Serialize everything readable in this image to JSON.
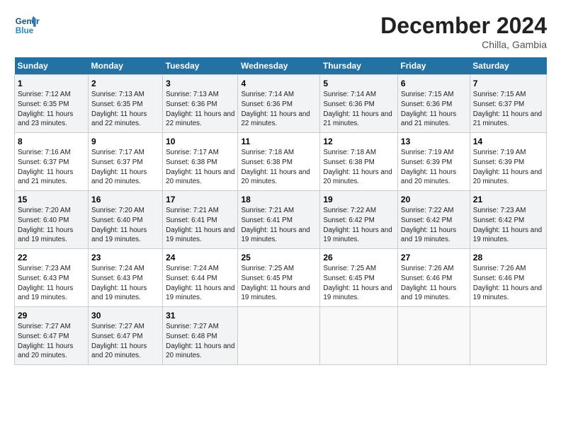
{
  "logo": {
    "line1": "General",
    "line2": "Blue"
  },
  "title": "December 2024",
  "subtitle": "Chilla, Gambia",
  "days_of_week": [
    "Sunday",
    "Monday",
    "Tuesday",
    "Wednesday",
    "Thursday",
    "Friday",
    "Saturday"
  ],
  "weeks": [
    [
      {
        "day": "1",
        "sunrise": "Sunrise: 7:12 AM",
        "sunset": "Sunset: 6:35 PM",
        "daylight": "Daylight: 11 hours and 23 minutes."
      },
      {
        "day": "2",
        "sunrise": "Sunrise: 7:13 AM",
        "sunset": "Sunset: 6:35 PM",
        "daylight": "Daylight: 11 hours and 22 minutes."
      },
      {
        "day": "3",
        "sunrise": "Sunrise: 7:13 AM",
        "sunset": "Sunset: 6:36 PM",
        "daylight": "Daylight: 11 hours and 22 minutes."
      },
      {
        "day": "4",
        "sunrise": "Sunrise: 7:14 AM",
        "sunset": "Sunset: 6:36 PM",
        "daylight": "Daylight: 11 hours and 22 minutes."
      },
      {
        "day": "5",
        "sunrise": "Sunrise: 7:14 AM",
        "sunset": "Sunset: 6:36 PM",
        "daylight": "Daylight: 11 hours and 21 minutes."
      },
      {
        "day": "6",
        "sunrise": "Sunrise: 7:15 AM",
        "sunset": "Sunset: 6:36 PM",
        "daylight": "Daylight: 11 hours and 21 minutes."
      },
      {
        "day": "7",
        "sunrise": "Sunrise: 7:15 AM",
        "sunset": "Sunset: 6:37 PM",
        "daylight": "Daylight: 11 hours and 21 minutes."
      }
    ],
    [
      {
        "day": "8",
        "sunrise": "Sunrise: 7:16 AM",
        "sunset": "Sunset: 6:37 PM",
        "daylight": "Daylight: 11 hours and 21 minutes."
      },
      {
        "day": "9",
        "sunrise": "Sunrise: 7:17 AM",
        "sunset": "Sunset: 6:37 PM",
        "daylight": "Daylight: 11 hours and 20 minutes."
      },
      {
        "day": "10",
        "sunrise": "Sunrise: 7:17 AM",
        "sunset": "Sunset: 6:38 PM",
        "daylight": "Daylight: 11 hours and 20 minutes."
      },
      {
        "day": "11",
        "sunrise": "Sunrise: 7:18 AM",
        "sunset": "Sunset: 6:38 PM",
        "daylight": "Daylight: 11 hours and 20 minutes."
      },
      {
        "day": "12",
        "sunrise": "Sunrise: 7:18 AM",
        "sunset": "Sunset: 6:38 PM",
        "daylight": "Daylight: 11 hours and 20 minutes."
      },
      {
        "day": "13",
        "sunrise": "Sunrise: 7:19 AM",
        "sunset": "Sunset: 6:39 PM",
        "daylight": "Daylight: 11 hours and 20 minutes."
      },
      {
        "day": "14",
        "sunrise": "Sunrise: 7:19 AM",
        "sunset": "Sunset: 6:39 PM",
        "daylight": "Daylight: 11 hours and 20 minutes."
      }
    ],
    [
      {
        "day": "15",
        "sunrise": "Sunrise: 7:20 AM",
        "sunset": "Sunset: 6:40 PM",
        "daylight": "Daylight: 11 hours and 19 minutes."
      },
      {
        "day": "16",
        "sunrise": "Sunrise: 7:20 AM",
        "sunset": "Sunset: 6:40 PM",
        "daylight": "Daylight: 11 hours and 19 minutes."
      },
      {
        "day": "17",
        "sunrise": "Sunrise: 7:21 AM",
        "sunset": "Sunset: 6:41 PM",
        "daylight": "Daylight: 11 hours and 19 minutes."
      },
      {
        "day": "18",
        "sunrise": "Sunrise: 7:21 AM",
        "sunset": "Sunset: 6:41 PM",
        "daylight": "Daylight: 11 hours and 19 minutes."
      },
      {
        "day": "19",
        "sunrise": "Sunrise: 7:22 AM",
        "sunset": "Sunset: 6:42 PM",
        "daylight": "Daylight: 11 hours and 19 minutes."
      },
      {
        "day": "20",
        "sunrise": "Sunrise: 7:22 AM",
        "sunset": "Sunset: 6:42 PM",
        "daylight": "Daylight: 11 hours and 19 minutes."
      },
      {
        "day": "21",
        "sunrise": "Sunrise: 7:23 AM",
        "sunset": "Sunset: 6:42 PM",
        "daylight": "Daylight: 11 hours and 19 minutes."
      }
    ],
    [
      {
        "day": "22",
        "sunrise": "Sunrise: 7:23 AM",
        "sunset": "Sunset: 6:43 PM",
        "daylight": "Daylight: 11 hours and 19 minutes."
      },
      {
        "day": "23",
        "sunrise": "Sunrise: 7:24 AM",
        "sunset": "Sunset: 6:43 PM",
        "daylight": "Daylight: 11 hours and 19 minutes."
      },
      {
        "day": "24",
        "sunrise": "Sunrise: 7:24 AM",
        "sunset": "Sunset: 6:44 PM",
        "daylight": "Daylight: 11 hours and 19 minutes."
      },
      {
        "day": "25",
        "sunrise": "Sunrise: 7:25 AM",
        "sunset": "Sunset: 6:45 PM",
        "daylight": "Daylight: 11 hours and 19 minutes."
      },
      {
        "day": "26",
        "sunrise": "Sunrise: 7:25 AM",
        "sunset": "Sunset: 6:45 PM",
        "daylight": "Daylight: 11 hours and 19 minutes."
      },
      {
        "day": "27",
        "sunrise": "Sunrise: 7:26 AM",
        "sunset": "Sunset: 6:46 PM",
        "daylight": "Daylight: 11 hours and 19 minutes."
      },
      {
        "day": "28",
        "sunrise": "Sunrise: 7:26 AM",
        "sunset": "Sunset: 6:46 PM",
        "daylight": "Daylight: 11 hours and 19 minutes."
      }
    ],
    [
      {
        "day": "29",
        "sunrise": "Sunrise: 7:27 AM",
        "sunset": "Sunset: 6:47 PM",
        "daylight": "Daylight: 11 hours and 20 minutes."
      },
      {
        "day": "30",
        "sunrise": "Sunrise: 7:27 AM",
        "sunset": "Sunset: 6:47 PM",
        "daylight": "Daylight: 11 hours and 20 minutes."
      },
      {
        "day": "31",
        "sunrise": "Sunrise: 7:27 AM",
        "sunset": "Sunset: 6:48 PM",
        "daylight": "Daylight: 11 hours and 20 minutes."
      },
      null,
      null,
      null,
      null
    ]
  ]
}
